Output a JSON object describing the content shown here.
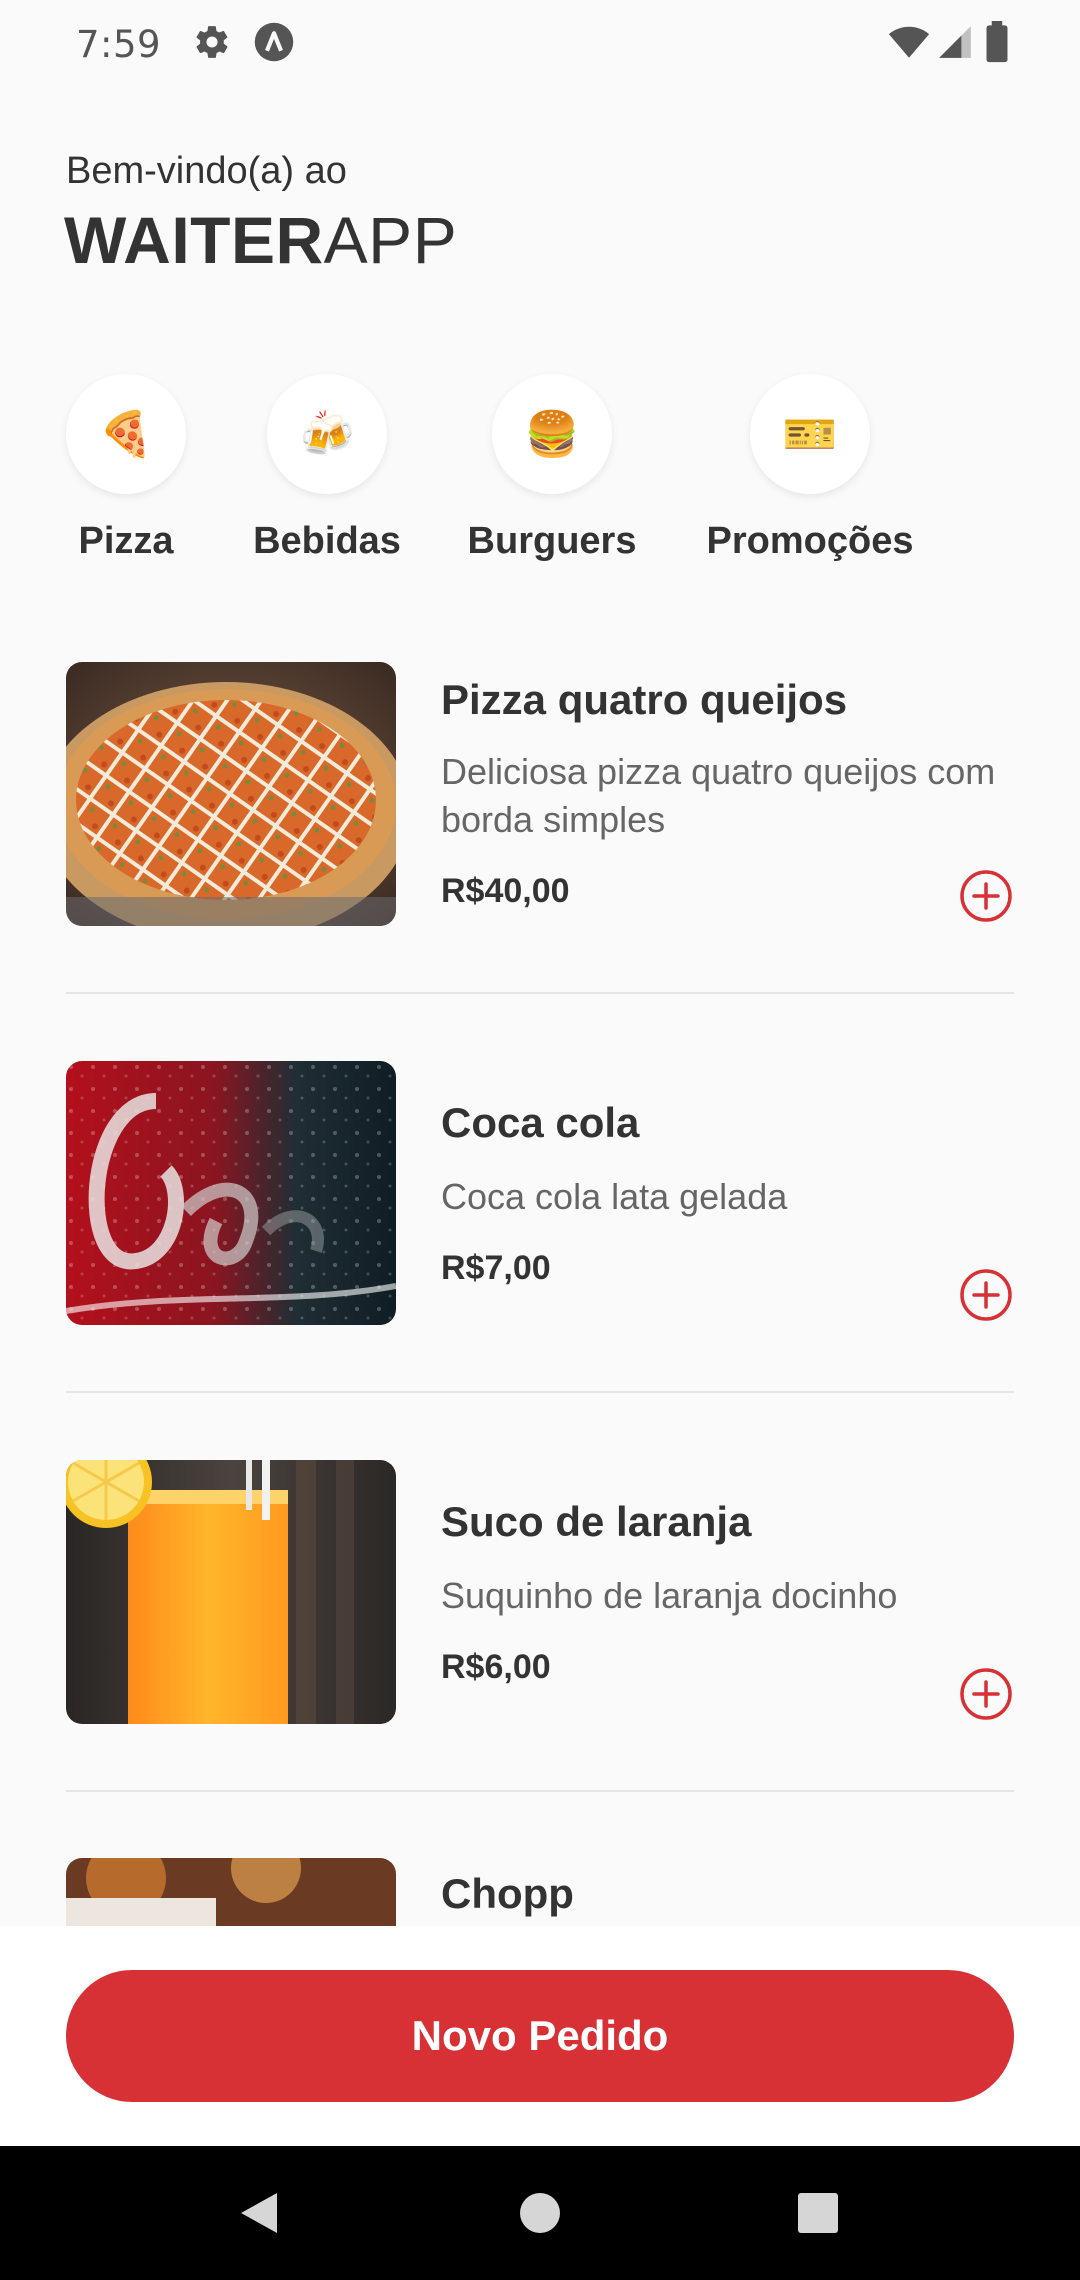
{
  "status_bar": {
    "time": "7:59",
    "icons": [
      "gear-icon",
      "app-a-icon",
      "wifi-icon",
      "cell-signal-icon",
      "battery-icon"
    ]
  },
  "header": {
    "greeting": "Bem-vindo(a) ao",
    "title_bold": "WAITER",
    "title_light": "APP"
  },
  "categories": [
    {
      "emoji": "🍕",
      "label": "Pizza"
    },
    {
      "emoji": "🍻",
      "label": "Bebidas"
    },
    {
      "emoji": "🍔",
      "label": "Burguers"
    },
    {
      "emoji": "🎫",
      "label": "Promoções"
    }
  ],
  "products": [
    {
      "name": "Pizza quatro queijos",
      "description": "Deliciosa pizza quatro queijos com borda simples",
      "price": "R$40,00"
    },
    {
      "name": "Coca cola",
      "description": "Coca cola lata gelada",
      "price": "R$7,00"
    },
    {
      "name": "Suco de laranja",
      "description": "Suquinho de laranja docinho",
      "price": "R$6,00"
    },
    {
      "name": "Chopp",
      "description": "",
      "price": ""
    }
  ],
  "footer": {
    "new_order_label": "Novo Pedido"
  },
  "colors": {
    "accent": "#d73035",
    "text": "#333333",
    "muted": "#666666",
    "background": "#fafafa"
  }
}
